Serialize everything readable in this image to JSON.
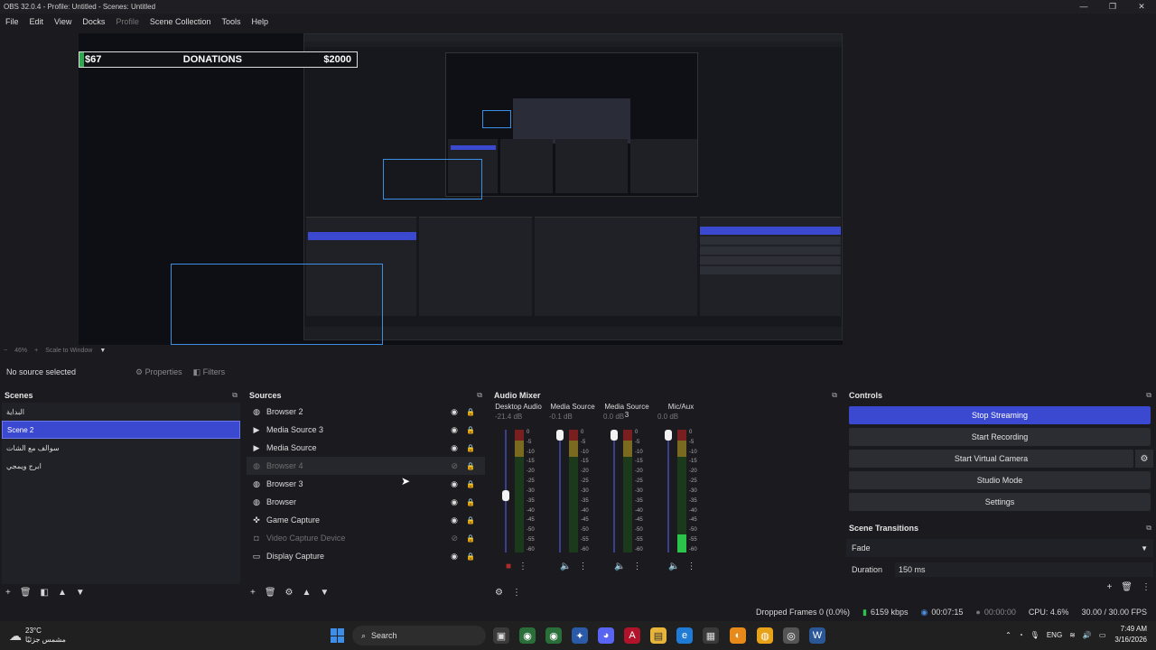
{
  "window": {
    "title": "OBS 32.0.4 - Profile: Untitled - Scenes: Untitled"
  },
  "menu": {
    "items": [
      {
        "label": "File",
        "dim": false
      },
      {
        "label": "Edit",
        "dim": false
      },
      {
        "label": "View",
        "dim": false
      },
      {
        "label": "Docks",
        "dim": false
      },
      {
        "label": "Profile",
        "dim": true
      },
      {
        "label": "Scene Collection",
        "dim": false
      },
      {
        "label": "Tools",
        "dim": false
      },
      {
        "label": "Help",
        "dim": false
      }
    ]
  },
  "preview": {
    "donations": {
      "left": "$67",
      "center": "DONATIONS",
      "right": "$2000"
    },
    "zoom": {
      "level": "46%",
      "mode": "Scale to Window"
    }
  },
  "source_toolbar": {
    "status": "No source selected",
    "properties": "Properties",
    "filters": "Filters"
  },
  "scenes": {
    "title": "Scenes",
    "items": [
      {
        "label": "البداية",
        "selected": false
      },
      {
        "label": "Scene 2",
        "selected": true
      },
      {
        "label": "سوالف مع الشات",
        "selected": false
      },
      {
        "label": "ابرج ويمجي",
        "selected": false
      }
    ]
  },
  "sources": {
    "title": "Sources",
    "items": [
      {
        "label": "Browser 2",
        "icon": "globe",
        "dim": false
      },
      {
        "label": "Media Source 3",
        "icon": "play",
        "dim": false
      },
      {
        "label": "Media Source",
        "icon": "play",
        "dim": false
      },
      {
        "label": "Browser 4",
        "icon": "globe",
        "dim": true
      },
      {
        "label": "Browser 3",
        "icon": "globe",
        "dim": false
      },
      {
        "label": "Browser",
        "icon": "globe",
        "dim": false
      },
      {
        "label": "Game Capture",
        "icon": "gamepad",
        "dim": false
      },
      {
        "label": "Video Capture Device",
        "icon": "camera",
        "dim": true
      },
      {
        "label": "Display Capture",
        "icon": "monitor",
        "dim": false
      }
    ]
  },
  "mixer": {
    "title": "Audio Mixer",
    "scale": [
      "0",
      "-5",
      "-10",
      "-15",
      "-20",
      "-25",
      "-30",
      "-35",
      "-40",
      "-45",
      "-50",
      "-55",
      "-60"
    ],
    "channels": [
      {
        "name": "Desktop Audio",
        "db": "-21.4 dB",
        "level": 0.0,
        "volume": 0.46,
        "muted": true
      },
      {
        "name": "Media Source",
        "db": "-0.1 dB",
        "level": 0.0,
        "volume": 1.0,
        "muted": false
      },
      {
        "name": "Media Source 3",
        "db": "0.0 dB",
        "level": 0.0,
        "volume": 1.0,
        "muted": false
      },
      {
        "name": "Mic/Aux",
        "db": "0.0 dB",
        "level": 0.15,
        "volume": 1.0,
        "muted": false
      }
    ]
  },
  "controls": {
    "title": "Controls",
    "buttons": [
      "Stop Streaming",
      "Start Recording",
      "Start Virtual Camera",
      "Studio Mode",
      "Settings"
    ]
  },
  "transitions": {
    "title": "Scene Transitions",
    "selected": "Fade",
    "duration_label": "Duration",
    "duration_value": "150 ms"
  },
  "status": {
    "dropped": "Dropped Frames 0 (0.0%)",
    "bitrate": "6159 kbps",
    "stream_time": "00:07:15",
    "rec_time": "00:00:00",
    "cpu": "CPU: 4.6%",
    "fps": "30.00 / 30.00 FPS"
  },
  "taskbar": {
    "temp": "23°C",
    "weather_text": "مشمس جزئيًا",
    "search": "Search",
    "lang": "ENG",
    "time": "7:49 AM",
    "date": "3/16/2026"
  },
  "colors": {
    "accent": "#3b49d1",
    "meter_green": "#2cc34a",
    "bg": "#1b1b1f"
  }
}
